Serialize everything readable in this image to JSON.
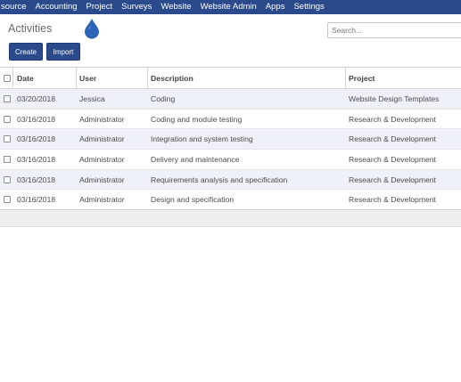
{
  "nav": {
    "menu": [
      "source",
      "Accounting",
      "Project",
      "Surveys",
      "Website",
      "Website Admin",
      "Apps",
      "Settings"
    ]
  },
  "control_panel": {
    "title": "Activities",
    "create_label": "Create",
    "import_label": "Import",
    "search_placeholder": "Search..."
  },
  "table": {
    "headers": {
      "date": "Date",
      "user": "User",
      "description": "Description",
      "project": "Project"
    },
    "rows": [
      {
        "date": "03/20/2018",
        "user": "Jessica",
        "description": "Coding",
        "project": "Website Design Templates"
      },
      {
        "date": "03/16/2018",
        "user": "Administrator",
        "description": "Coding and module testing",
        "project": "Research & Development"
      },
      {
        "date": "03/16/2018",
        "user": "Administrator",
        "description": "Integration and system testing",
        "project": "Research & Development"
      },
      {
        "date": "03/16/2018",
        "user": "Administrator",
        "description": "Delivery and maintenance",
        "project": "Research & Development"
      },
      {
        "date": "03/16/2018",
        "user": "Administrator",
        "description": "Requirements analysis and specification",
        "project": "Research & Development"
      },
      {
        "date": "03/16/2018",
        "user": "Administrator",
        "description": "Design and specification",
        "project": "Research & Development"
      }
    ]
  },
  "theme": {
    "navbar_color": "#2b4a8b",
    "accent_color": "#2b4a8b",
    "marker_color": "#2c64b8",
    "row_stripe_color": "#eef1f8"
  }
}
